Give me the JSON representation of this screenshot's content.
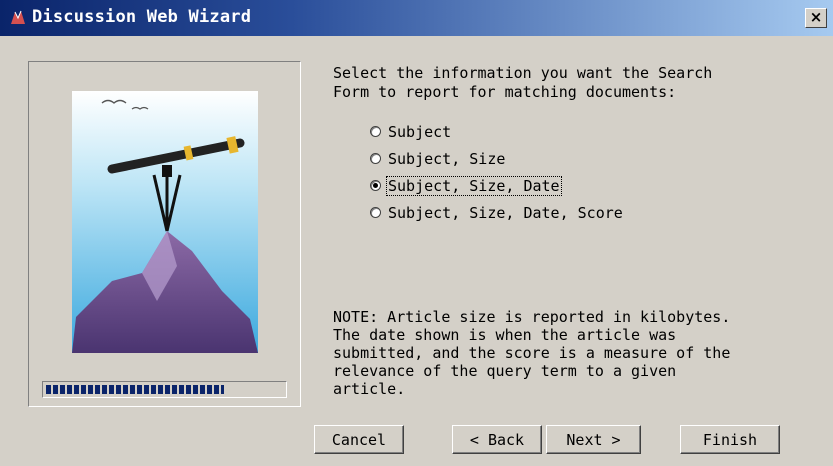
{
  "window": {
    "title": "Discussion Web Wizard",
    "close_label": "×"
  },
  "wizard": {
    "prompt": "Select the information you want the Search\nForm to report for matching documents:",
    "options": [
      {
        "label": "Subject",
        "checked": false
      },
      {
        "label": "Subject, Size",
        "checked": false
      },
      {
        "label": "Subject, Size, Date",
        "checked": true
      },
      {
        "label": "Subject, Size, Date, Score",
        "checked": false
      }
    ],
    "note": "NOTE: Article size is reported in kilobytes.\nThe date shown is when the article was\nsubmitted, and the score is a measure of the\nrelevance of the query term to a given\narticle.",
    "progress": 0.75
  },
  "buttons": {
    "cancel": "Cancel",
    "back": "< Back",
    "next": "Next >",
    "finish": "Finish"
  },
  "illustration": {
    "icon": "telescope-on-mountain"
  }
}
